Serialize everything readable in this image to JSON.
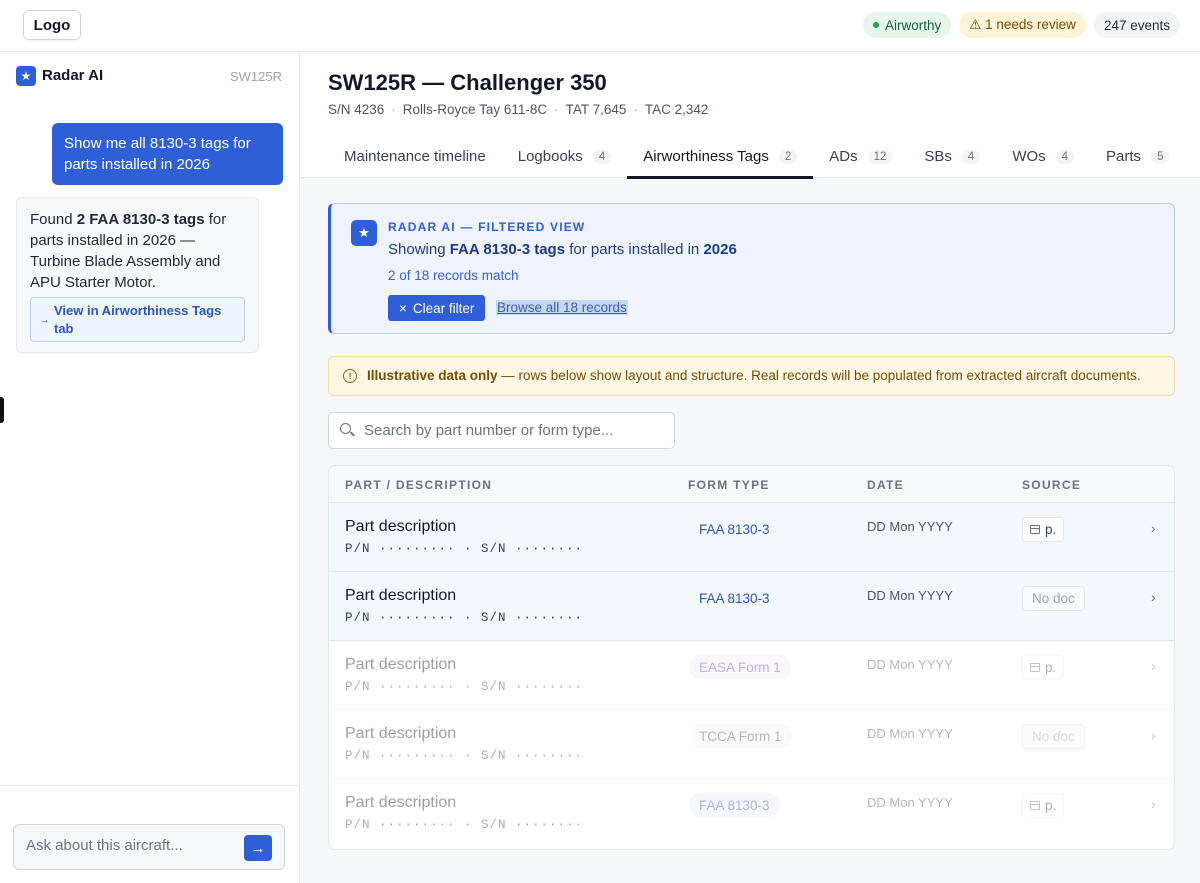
{
  "topbar": {
    "logo": "Logo",
    "status_airworthy": "Airworthy",
    "status_review": "⚠ 1 needs review",
    "events": "247 events"
  },
  "sidebar": {
    "title": "Radar AI",
    "tail": "SW125R",
    "user_message": "Show me all 8130-3 tags for parts installed in 2026",
    "ai_reply": {
      "pre": "Found ",
      "bold": "2 FAA 8130-3 tags",
      "post": " for parts installed in 2026 — Turbine Blade Assembly and APU Starter Motor.",
      "link": "View in Airworthiness Tags tab",
      "link_icon": "→"
    },
    "ask_placeholder": "Ask about this aircraft...",
    "send_icon": "→"
  },
  "header": {
    "title": "SW125R — Challenger 350",
    "meta": [
      "S/N 4236",
      "Rolls-Royce Tay 611-8C",
      "TAT 7,645",
      "TAC 2,342"
    ],
    "meta_sep": "·"
  },
  "tabs": [
    {
      "label": "Maintenance timeline",
      "count": ""
    },
    {
      "label": "Logbooks",
      "count": "4"
    },
    {
      "label": "Airworthiness Tags",
      "count": "2"
    },
    {
      "label": "ADs",
      "count": "12"
    },
    {
      "label": "SBs",
      "count": "4"
    },
    {
      "label": "WOs",
      "count": "4"
    },
    {
      "label": "Parts",
      "count": "5"
    }
  ],
  "filter": {
    "label": "RADAR AI — FILTERED VIEW",
    "desc_pre": "Showing ",
    "desc_bold1": "FAA 8130-3 tags",
    "desc_mid": " for parts installed in ",
    "desc_bold2": "2026",
    "count": "2 of 18 records match",
    "clear_label": "Clear filter",
    "clear_icon": "×",
    "browse_label": "Browse all 18 records",
    "icon": "★"
  },
  "notice": {
    "icon": "!",
    "bold": "Illustrative data only",
    "text": " — rows below show layout and structure. Real records will be populated from extracted aircraft documents."
  },
  "search": {
    "placeholder": "Search by part number or form type..."
  },
  "table": {
    "headers": [
      "PART / DESCRIPTION",
      "FORM TYPE",
      "DATE",
      "SOURCE"
    ],
    "rows": [
      {
        "desc": "Part description",
        "pn": "P/N ········· · S/N ········",
        "form": "FAA 8130-3",
        "date": "DD Mon YYYY",
        "source": "p."
      },
      {
        "desc": "Part description",
        "pn": "P/N ········· · S/N ········",
        "form": "FAA 8130-3",
        "date": "DD Mon YYYY",
        "source": "No doc"
      },
      {
        "desc": "Part description",
        "pn": "P/N ········· · S/N ········",
        "form": "EASA Form 1",
        "date": "DD Mon YYYY",
        "source": "p."
      },
      {
        "desc": "Part description",
        "pn": "P/N ········· · S/N ········",
        "form": "TCCA Form 1",
        "date": "DD Mon YYYY",
        "source": "No doc"
      },
      {
        "desc": "Part description",
        "pn": "P/N ········· · S/N ········",
        "form": "FAA 8130-3",
        "date": "DD Mon YYYY",
        "source": "p."
      }
    ],
    "chevron": "›"
  }
}
